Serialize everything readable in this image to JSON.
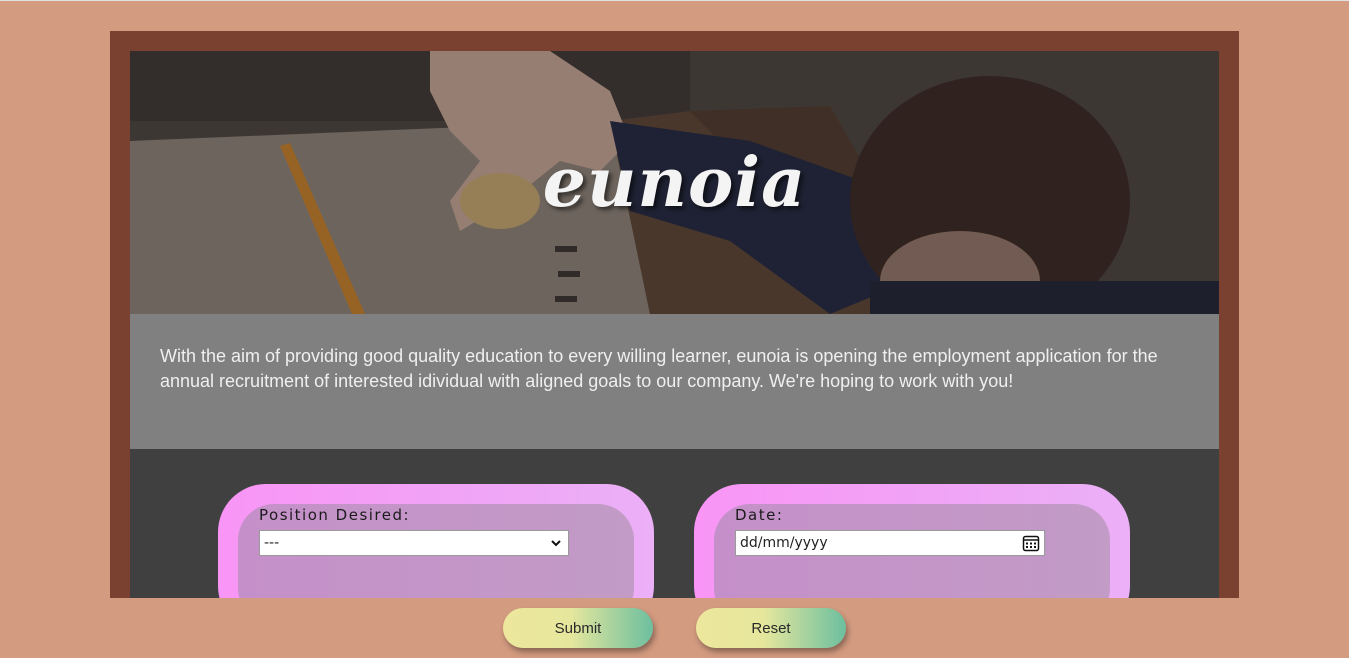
{
  "header": {
    "title": "eunoia"
  },
  "intro": {
    "text": "With the aim of providing good quality education to every willing learner, eunoia is opening the employment application for the annual recruitment of interested idividual with aligned goals to our company. We're hoping to work with you!"
  },
  "form": {
    "position": {
      "label": "Position Desired:",
      "selected": "---"
    },
    "date": {
      "label": "Date:",
      "placeholder": "dd/mm/yyyy"
    }
  },
  "buttons": {
    "submit": "Submit",
    "reset": "Reset"
  },
  "colors": {
    "page_background": "#d39b80",
    "frame": "#7a4131",
    "intro_background": "#808080",
    "form_background": "#404040",
    "card_outer": "#f995f6",
    "card_inner": "#c590c9",
    "button_gradient_start": "#ece79c",
    "button_gradient_end": "#6cbf9f"
  }
}
